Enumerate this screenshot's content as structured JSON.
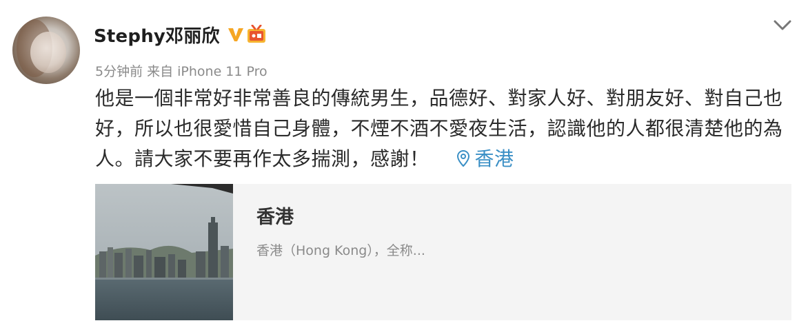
{
  "post": {
    "username": "Stephy邓丽欣",
    "time": "5分钟前",
    "source": "来自 iPhone 11 Pro",
    "text": "他是一個非常好非常善良的傳統男生，品德好、對家人好、對朋友好、對自己也好，所以也很愛惜自己身體，不煙不酒不愛夜生活，認識他的人都很清楚他的為人。請大家不要再作太多揣測，感謝！",
    "location": "香港"
  },
  "card": {
    "title": "香港",
    "description": "香港（Hong Kong），全称..."
  },
  "icons": {
    "verified": "vip-v-icon",
    "member": "member-badge-icon",
    "menu": "chevron-down-icon",
    "location": "location-pin-icon"
  },
  "colors": {
    "link": "#3a8fc5",
    "verified": "#f5a623",
    "card_bg": "#f4f4f4",
    "meta": "#8a8a8a"
  }
}
